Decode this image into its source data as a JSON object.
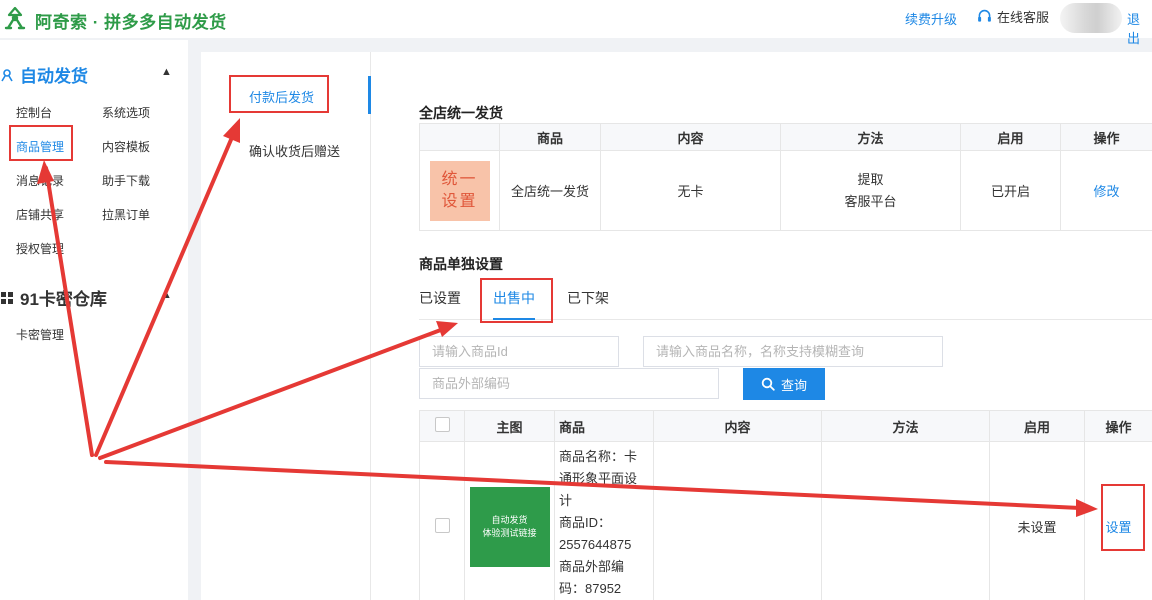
{
  "header": {
    "brand": "阿奇索 · 拼多多自动发货",
    "renew": "续费升级",
    "customer_service": "在线客服",
    "logout": "退出"
  },
  "sidebar": {
    "group1": "自动发货",
    "items1": [
      "控制台",
      "系统选项",
      "商品管理",
      "内容模板",
      "消息记录",
      "助手下载",
      "店铺共享",
      "拉黑订单",
      "授权管理"
    ],
    "group2": "91卡密仓库",
    "items2": [
      "卡密管理"
    ],
    "active": "商品管理"
  },
  "subnav": {
    "items": [
      "付款后发货",
      "确认收货后赠送"
    ],
    "active": "付款后发货"
  },
  "store_wide": {
    "title": "全店统一发货",
    "headers": [
      "商品",
      "内容",
      "方法",
      "启用",
      "操作"
    ],
    "thumb_line1": "统一",
    "thumb_line2": "设置",
    "product": "全店统一发货",
    "content": "无卡",
    "method_line1": "提取",
    "method_line2": "客服平台",
    "enabled": "已开启",
    "action": "修改"
  },
  "individual": {
    "title": "商品单独设置",
    "tabs": [
      "已设置",
      "出售中",
      "已下架"
    ],
    "active_tab": "出售中"
  },
  "search": {
    "id_placeholder": "请输入商品Id",
    "name_placeholder": "请输入商品名称，名称支持模糊查询",
    "code_placeholder": "商品外部编码",
    "query_button": "查询"
  },
  "product_table": {
    "headers": [
      "主图",
      "商品",
      "内容",
      "方法",
      "启用",
      "操作"
    ],
    "rows": [
      {
        "image_line1": "自动发货",
        "image_line2": "体验测试链接",
        "info": [
          "商品名称：卡",
          "通形象平面设",
          "计",
          "商品ID：",
          "2557644875",
          "商品外部编",
          "码：87952"
        ],
        "content": "",
        "method": "",
        "enabled": "未设置",
        "action": "设置"
      }
    ]
  },
  "colors": {
    "brand_green": "#2e9b48",
    "accent_blue": "#1e88e5",
    "annotation_red": "#e53935"
  }
}
